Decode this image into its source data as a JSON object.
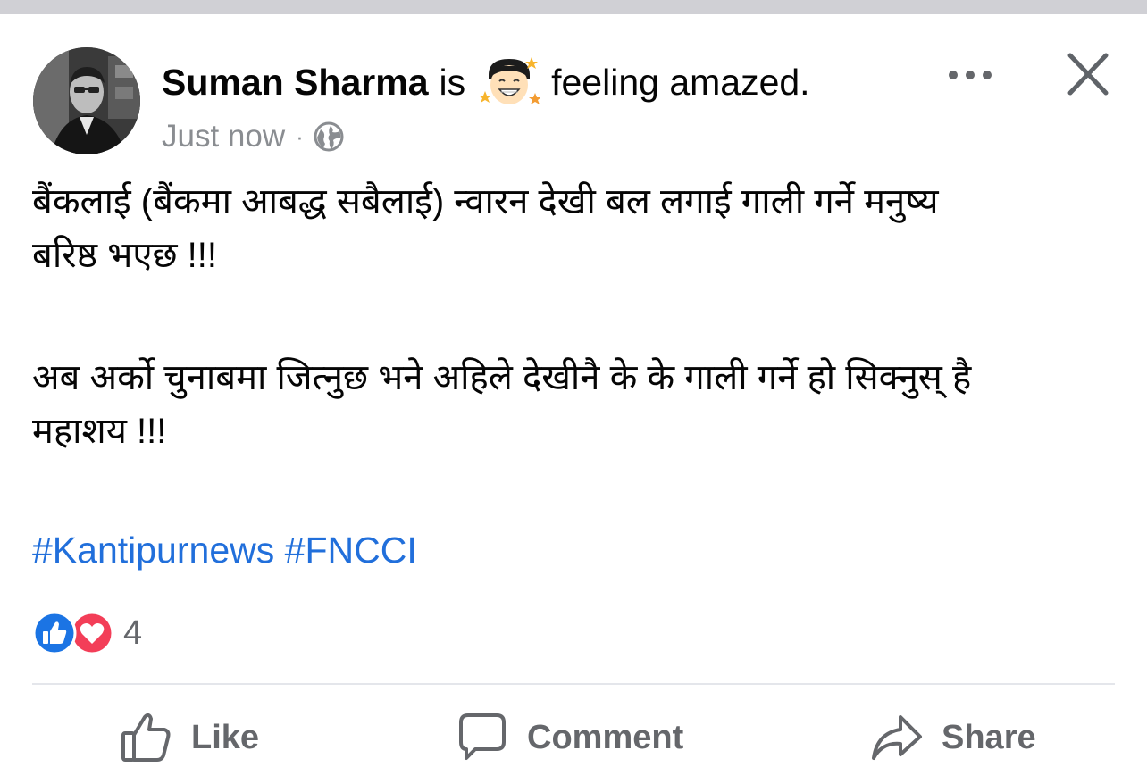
{
  "post": {
    "author": "Suman Sharma",
    "is_word": "is",
    "feeling_icon": "amazed-face-emoji",
    "feeling": "feeling amazed.",
    "timestamp": "Just now",
    "separator": "·",
    "audience_icon": "globe-icon",
    "paragraphs": [
      [
        "बैंकलाई (बैंकमा आबद्ध सबैलाई) न्वारन देखी बल लगाई गाली गर्ने मनुष्य",
        "बरिष्ठ भएछ !!!"
      ],
      [
        "अब अर्को चुनाबमा जित्नुछ भने अहिले देखीनै के के गाली गर्ने  हो सिक्नुस्  है",
        "महाशय !!!"
      ]
    ],
    "hashtags": [
      "#Kantipurnews",
      "#FNCCI"
    ]
  },
  "reactions": {
    "types": [
      "like",
      "love"
    ],
    "count": "4"
  },
  "actions": {
    "like": "Like",
    "comment": "Comment",
    "share": "Share"
  },
  "colors": {
    "link": "#216fdb",
    "like_blue": "#1b74e4",
    "love_red": "#f33e58",
    "muted": "#65676b"
  }
}
